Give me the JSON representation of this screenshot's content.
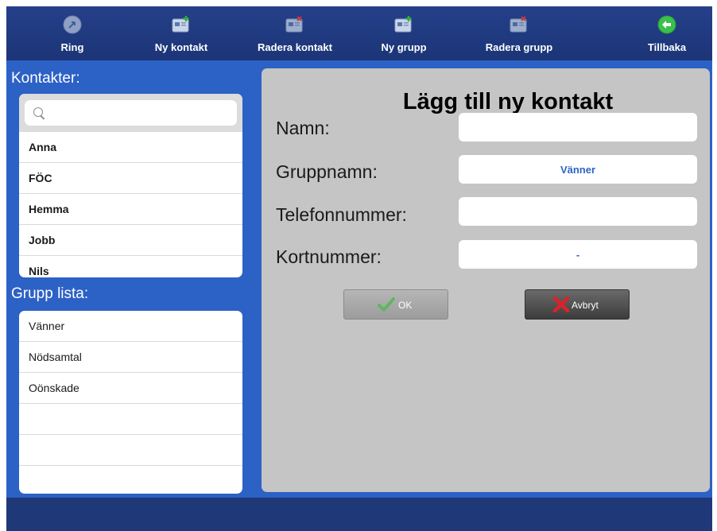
{
  "toolbar": {
    "items": [
      {
        "label": "Ring",
        "icon": "phone-call-icon"
      },
      {
        "label": "Ny kontakt",
        "icon": "add-contact-icon"
      },
      {
        "label": "Radera kontakt",
        "icon": "delete-contact-icon"
      },
      {
        "label": "Ny grupp",
        "icon": "add-group-icon"
      },
      {
        "label": "Radera grupp",
        "icon": "delete-group-icon"
      },
      {
        "label": "Tillbaka",
        "icon": "back-arrow-icon"
      }
    ]
  },
  "sidebar": {
    "contacts_heading": "Kontakter:",
    "search": {
      "placeholder": "",
      "value": ""
    },
    "contacts": [
      "Anna",
      "FÖC",
      "Hemma",
      "Jobb",
      "Nils"
    ],
    "groups_heading": "Grupp lista:",
    "groups": [
      "Vänner",
      "Nödsamtal",
      "Oönskade"
    ]
  },
  "form": {
    "title": "Lägg till ny kontakt",
    "fields": [
      {
        "label": "Namn:",
        "value": ""
      },
      {
        "label": "Gruppnamn:",
        "value": "Vänner"
      },
      {
        "label": "Telefonnummer:",
        "value": ""
      },
      {
        "label": "Kortnummer:",
        "value": "-"
      }
    ],
    "ok_label": "OK",
    "cancel_label": "Avbryt"
  },
  "colors": {
    "toolbar": "#1f3a7e",
    "background": "#2c61c6",
    "panel": "#c5c5c5",
    "accent_value": "#2c65c4",
    "ok_check": "#5cb85c",
    "cancel_x": "#d9232b"
  }
}
